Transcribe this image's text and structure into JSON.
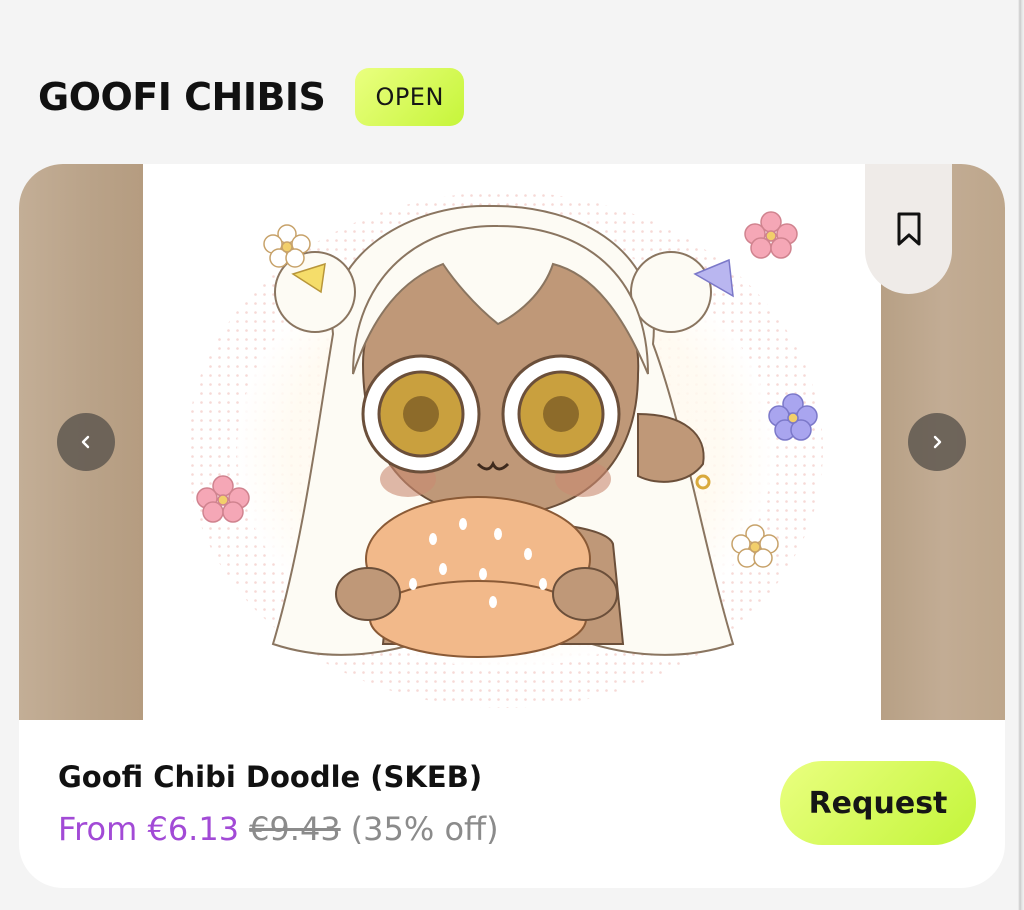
{
  "section": {
    "title": "GOOFI CHIBIS",
    "status_badge": "OPEN"
  },
  "product": {
    "name": "Goofi Chibi Doodle (SKEB)",
    "price_from": "From €6.13",
    "price_original": "€9.43",
    "discount": "(35% off)",
    "request_label": "Request"
  },
  "gallery": {
    "image": "chibi-character-holding-burger",
    "prev_icon": "chevron-left-icon",
    "next_icon": "chevron-right-icon",
    "bookmark_icon": "bookmark-icon"
  },
  "colors": {
    "accent_green": "#d4fa5a",
    "price_purple": "#a24ad6"
  }
}
